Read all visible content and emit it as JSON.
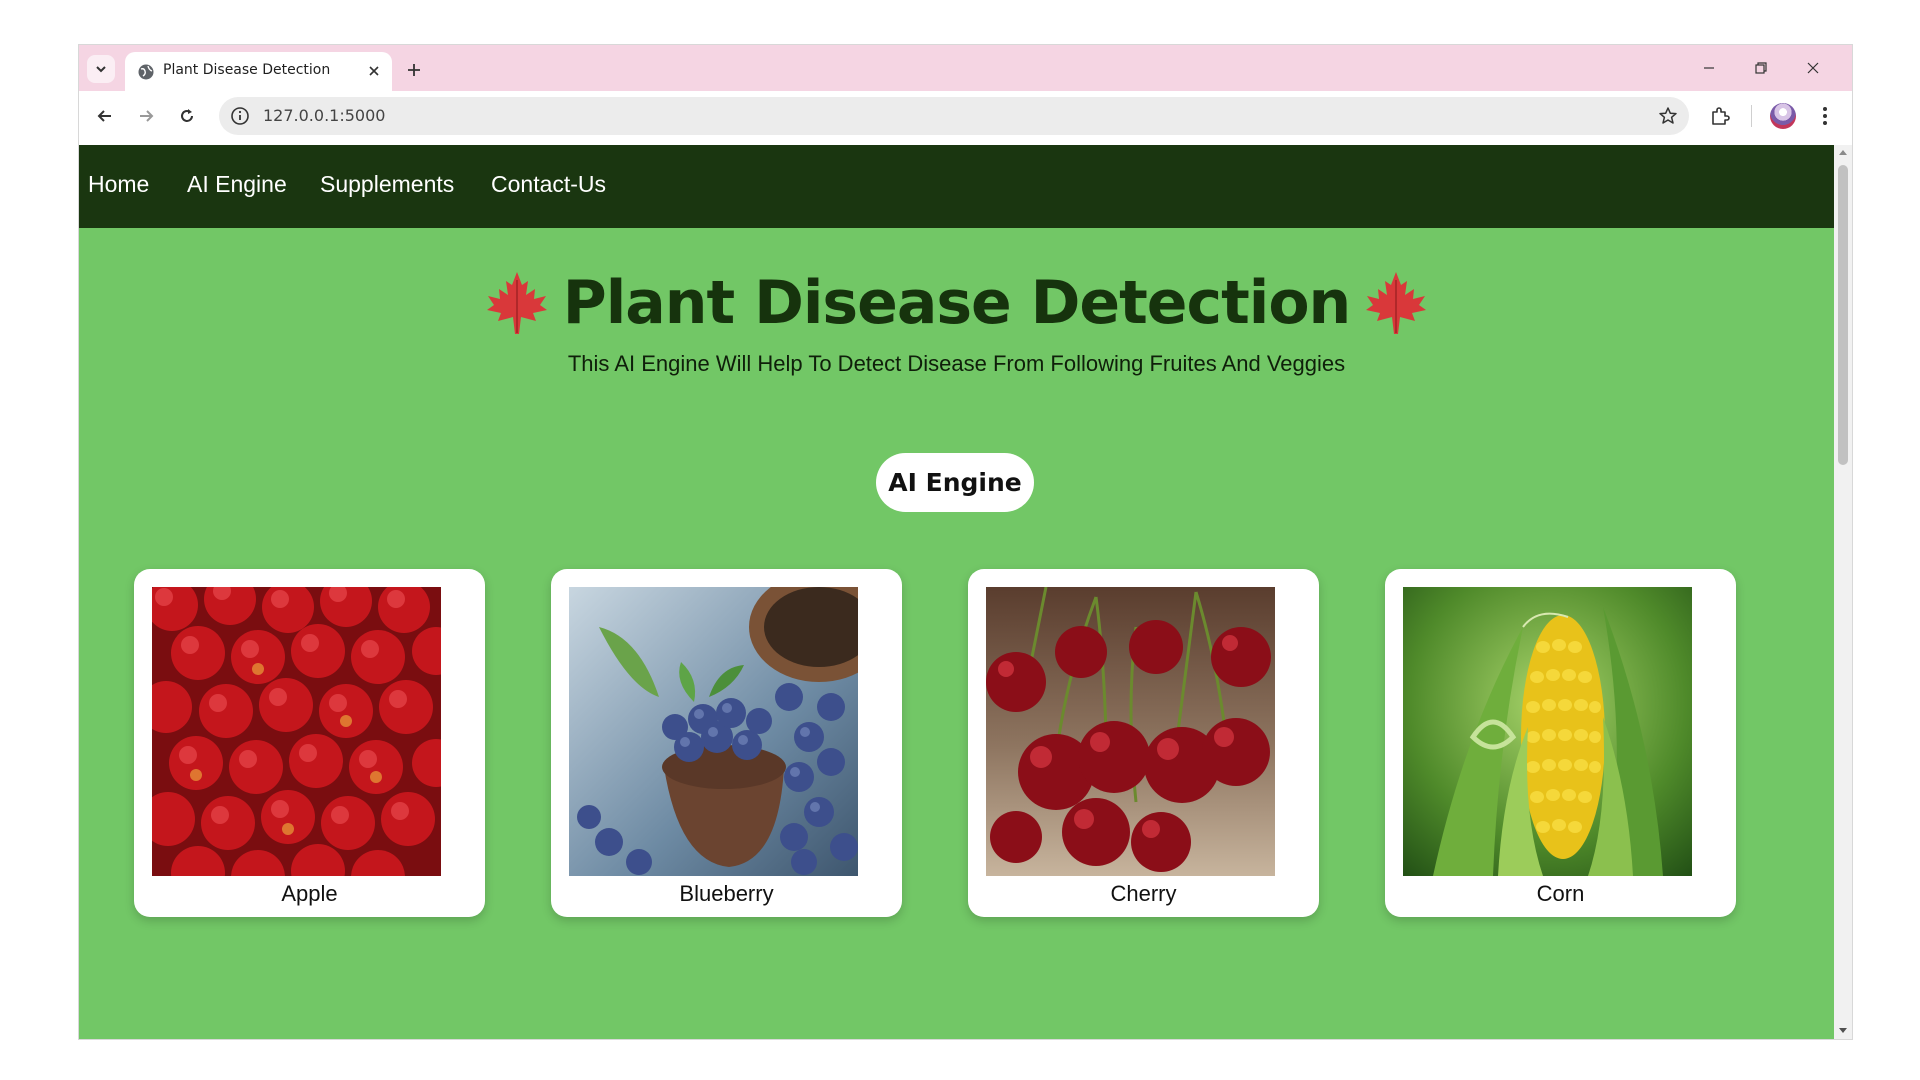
{
  "browser": {
    "tab": {
      "title": "Plant Disease Detection"
    },
    "address": {
      "url": "127.0.0.1:5000"
    }
  },
  "nav": {
    "items": [
      {
        "label": "Home"
      },
      {
        "label": "AI Engine"
      },
      {
        "label": "Supplements"
      },
      {
        "label": "Contact-Us"
      }
    ]
  },
  "hero": {
    "title": "Plant Disease Detection",
    "subtitle": "This AI Engine Will Help To Detect Disease From Following Fruites And Veggies",
    "icon": "maple-leaf-icon"
  },
  "cta": {
    "label": "AI Engine"
  },
  "cards": [
    {
      "label": "Apple",
      "image": "apple-image"
    },
    {
      "label": "Blueberry",
      "image": "blueberry-image"
    },
    {
      "label": "Cherry",
      "image": "cherry-image"
    },
    {
      "label": "Corn",
      "image": "corn-image"
    }
  ],
  "colors": {
    "page_bg": "#72c766",
    "nav_bg": "#1a3610",
    "title_color": "#16330d",
    "leaf_color": "#d9383a",
    "tabstrip_bg": "#f5d5e3"
  }
}
